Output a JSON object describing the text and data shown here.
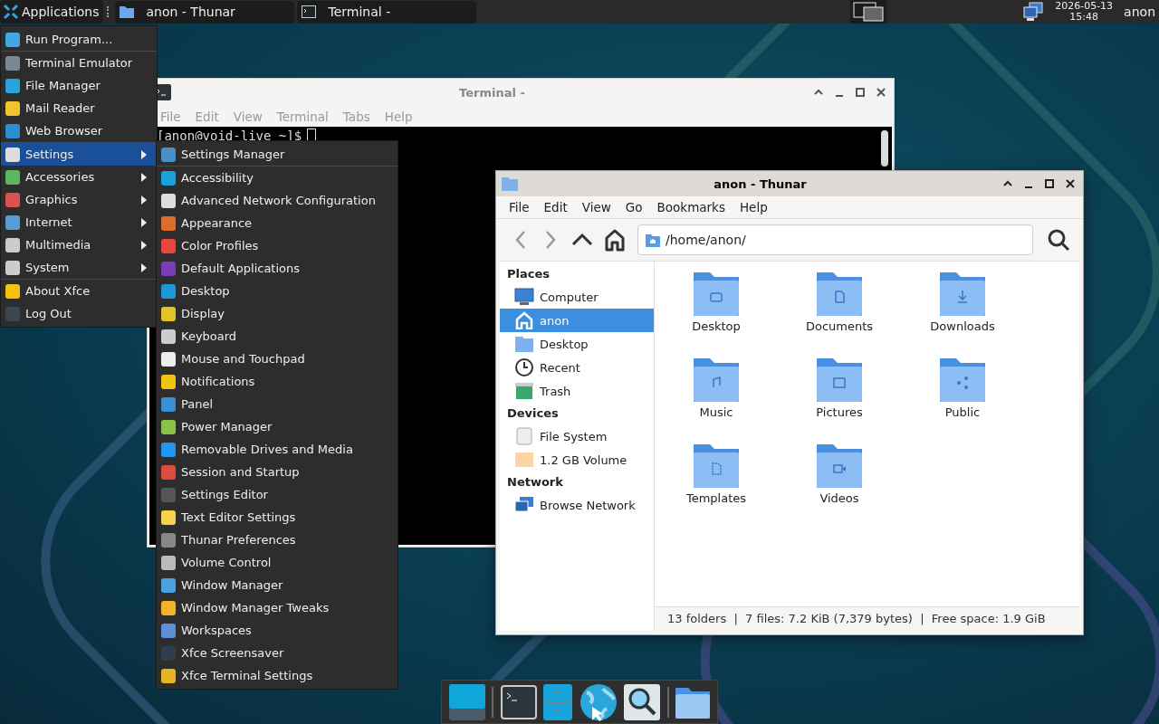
{
  "panel": {
    "apps_label": "Applications",
    "tasks": [
      {
        "title": "anon - Thunar",
        "kind": "folder"
      },
      {
        "title": "Terminal -",
        "kind": "terminal"
      }
    ],
    "clock": {
      "date": "2026-05-13",
      "time": "15:48"
    },
    "user": "anon"
  },
  "terminal": {
    "title": "Terminal -",
    "menu": [
      "File",
      "Edit",
      "View",
      "Terminal",
      "Tabs",
      "Help"
    ],
    "prompt": "[anon@void-live ~]$"
  },
  "app_menu": {
    "items": [
      {
        "label": "Run Program...",
        "has_submenu": false,
        "selected": false,
        "separator_after": true
      },
      {
        "label": "Terminal Emulator",
        "has_submenu": false,
        "selected": false,
        "separator_after": false
      },
      {
        "label": "File Manager",
        "has_submenu": false,
        "selected": false,
        "separator_after": false
      },
      {
        "label": "Mail Reader",
        "has_submenu": false,
        "selected": false,
        "separator_after": false
      },
      {
        "label": "Web Browser",
        "has_submenu": false,
        "selected": false,
        "separator_after": true
      },
      {
        "label": "Settings",
        "has_submenu": true,
        "selected": true,
        "separator_after": false
      },
      {
        "label": "Accessories",
        "has_submenu": true,
        "selected": false,
        "separator_after": false
      },
      {
        "label": "Graphics",
        "has_submenu": true,
        "selected": false,
        "separator_after": false
      },
      {
        "label": "Internet",
        "has_submenu": true,
        "selected": false,
        "separator_after": false
      },
      {
        "label": "Multimedia",
        "has_submenu": true,
        "selected": false,
        "separator_after": false
      },
      {
        "label": "System",
        "has_submenu": true,
        "selected": false,
        "separator_after": true
      },
      {
        "label": "About Xfce",
        "has_submenu": false,
        "selected": false,
        "separator_after": false
      },
      {
        "label": "Log Out",
        "has_submenu": false,
        "selected": false,
        "separator_after": false
      }
    ]
  },
  "settings_menu": {
    "items": [
      {
        "label": "Settings Manager",
        "separator_after": true
      },
      {
        "label": "Accessibility",
        "separator_after": false
      },
      {
        "label": "Advanced Network Configuration",
        "separator_after": false
      },
      {
        "label": "Appearance",
        "separator_after": false
      },
      {
        "label": "Color Profiles",
        "separator_after": false
      },
      {
        "label": "Default Applications",
        "separator_after": false
      },
      {
        "label": "Desktop",
        "separator_after": false
      },
      {
        "label": "Display",
        "separator_after": false
      },
      {
        "label": "Keyboard",
        "separator_after": false
      },
      {
        "label": "Mouse and Touchpad",
        "separator_after": false
      },
      {
        "label": "Notifications",
        "separator_after": false
      },
      {
        "label": "Panel",
        "separator_after": false
      },
      {
        "label": "Power Manager",
        "separator_after": false
      },
      {
        "label": "Removable Drives and Media",
        "separator_after": false
      },
      {
        "label": "Session and Startup",
        "separator_after": false
      },
      {
        "label": "Settings Editor",
        "separator_after": false
      },
      {
        "label": "Text Editor Settings",
        "separator_after": false
      },
      {
        "label": "Thunar Preferences",
        "separator_after": false
      },
      {
        "label": "Volume Control",
        "separator_after": false
      },
      {
        "label": "Window Manager",
        "separator_after": false
      },
      {
        "label": "Window Manager Tweaks",
        "separator_after": false
      },
      {
        "label": "Workspaces",
        "separator_after": false
      },
      {
        "label": "Xfce Screensaver",
        "separator_after": false
      },
      {
        "label": "Xfce Terminal Settings",
        "separator_after": false
      }
    ]
  },
  "thunar": {
    "title": "anon - Thunar",
    "menu": [
      "File",
      "Edit",
      "View",
      "Go",
      "Bookmarks",
      "Help"
    ],
    "toolbar": {
      "back_disabled": true,
      "forward_disabled": true,
      "location": "/home/anon/"
    },
    "sidebar": [
      {
        "heading": "Places",
        "items": [
          {
            "label": "Computer",
            "selected": false
          },
          {
            "label": "anon",
            "selected": true
          },
          {
            "label": "Desktop",
            "selected": false
          },
          {
            "label": "Recent",
            "selected": false
          },
          {
            "label": "Trash",
            "selected": false
          }
        ]
      },
      {
        "heading": "Devices",
        "items": [
          {
            "label": "File System",
            "selected": false
          },
          {
            "label": "1.2 GB Volume",
            "selected": false
          }
        ]
      },
      {
        "heading": "Network",
        "items": [
          {
            "label": "Browse Network",
            "selected": false
          }
        ]
      }
    ],
    "folders": [
      "Desktop",
      "Documents",
      "Downloads",
      "Music",
      "Pictures",
      "Public",
      "Templates",
      "Videos"
    ],
    "status_bar": "13 folders  |  7 files: 7.2 KiB (7,379 bytes)  |  Free space: 1.9 GiB"
  }
}
